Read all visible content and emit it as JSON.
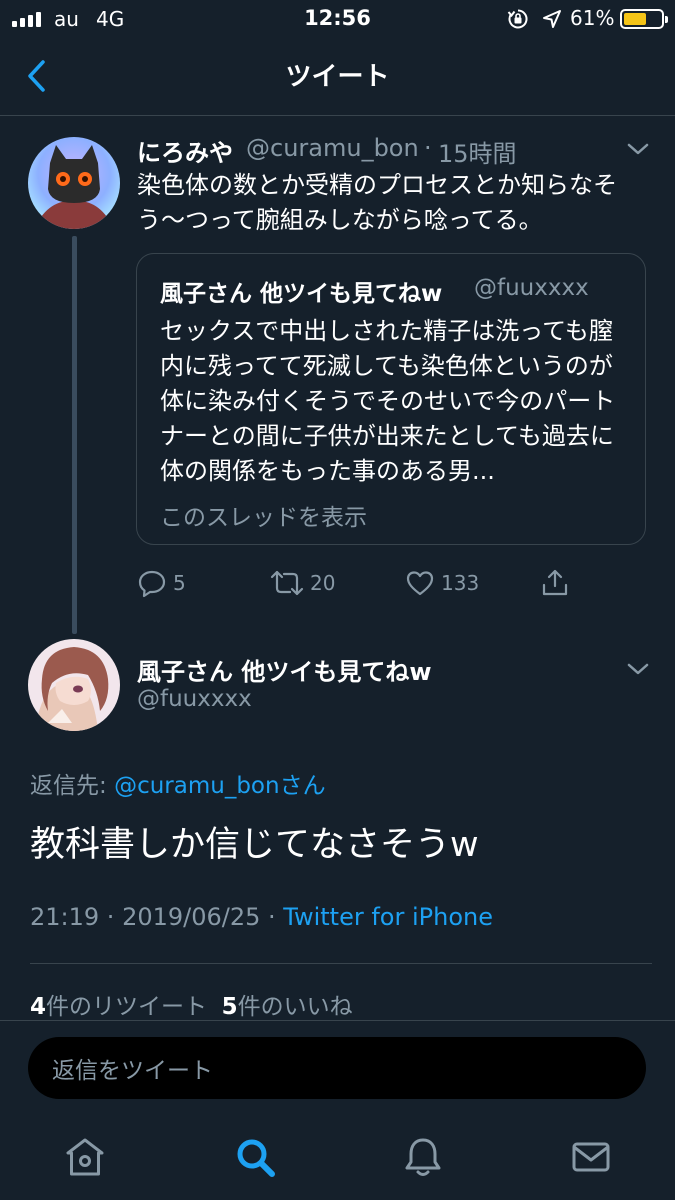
{
  "status_bar": {
    "carrier": "au",
    "network": "4G",
    "time": "12:56",
    "battery_percent": "61%",
    "battery_level": 0.61,
    "battery_color": "#f5c518"
  },
  "header": {
    "title": "ツイート",
    "back_icon": "chevron-left-icon"
  },
  "quoting_tweet": {
    "author_name": "にろみや",
    "handle": "@curamu_bon",
    "separator": "·",
    "time": "15時間",
    "text": "染色体の数とか受精のプロセスとか知らなそう〜つって腕組みしながら唸ってる。",
    "quoted": {
      "author_name": "風子さん 他ツイも見てねw",
      "handle": "@fuuxxxx",
      "text": "セックスで中出しされた精子は洗っても膣内に残ってて死滅しても染色体というのが体に染み付くそうでそのせいで今のパートナーとの間に子供が出来たとしても過去に体の関係をもった事のある男...",
      "show_thread": "このスレッドを表示"
    },
    "actions": {
      "replies": "5",
      "retweets": "20",
      "likes": "133"
    }
  },
  "main_tweet": {
    "author_name": "風子さん 他ツイも見てねw",
    "handle": "@fuuxxxx",
    "reply_prefix": "返信先: ",
    "reply_mention": "@curamu_bonさん",
    "text": "教科書しか信じてなさそうw",
    "time": "21:19",
    "date": "2019/06/25",
    "meta_sep": " · ",
    "client": "Twitter for iPhone",
    "retweet_count": "4",
    "retweet_label": "件のリツイート",
    "like_count": "5",
    "like_label": "件のいいね"
  },
  "reply_bar": {
    "placeholder": "返信をツイート"
  },
  "tab_bar": {
    "items": [
      "home-icon",
      "search-icon",
      "notifications-icon",
      "messages-icon"
    ],
    "active_color": "#1da1f2",
    "inactive_color": "#8899a6"
  },
  "colors": {
    "background": "#15202b",
    "accent": "#1da1f2",
    "secondary_text": "#8899a6",
    "divider": "#38444d"
  }
}
